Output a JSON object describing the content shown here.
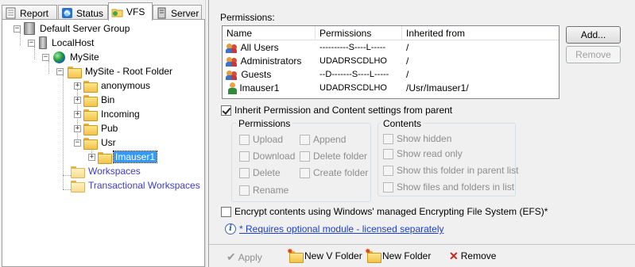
{
  "tabs": [
    {
      "label": "Report",
      "icon": "report-icon"
    },
    {
      "label": "Status",
      "icon": "status-icon"
    },
    {
      "label": "VFS",
      "icon": "vfs-folder-icon",
      "active": true
    },
    {
      "label": "Server",
      "icon": "server-tab-icon"
    }
  ],
  "tree": {
    "server_group": "Default Server Group",
    "host": "LocalHost",
    "site": "MySite",
    "root": "MySite - Root Folder",
    "folders": [
      "anonymous",
      "Bin",
      "Incoming",
      "Pub",
      "Usr"
    ],
    "selected_child": "Imauser1",
    "workspaces": "Workspaces",
    "transactional": "Transactional Workspaces"
  },
  "permissions": {
    "label": "Permissions:",
    "columns": [
      "Name",
      "Permissions",
      "Inherited from"
    ],
    "rows": [
      {
        "name": "All Users",
        "perms": "----------S----L-----",
        "inherited": "/",
        "icon": "user-group-icon"
      },
      {
        "name": "Administrators",
        "perms": "UDADRSCDLHO",
        "inherited": "/",
        "icon": "user-group-icon"
      },
      {
        "name": "Guests",
        "perms": "--D-------S----L-----",
        "inherited": "/",
        "icon": "user-group-icon"
      },
      {
        "name": "Imauser1",
        "perms": "UDADRSCDLHO",
        "inherited": "/Usr/Imauser1/",
        "icon": "user-icon"
      }
    ],
    "add_button": "Add...",
    "remove_button": "Remove"
  },
  "inherit": {
    "label": "Inherit Permission and Content settings from parent",
    "checked": true
  },
  "perm_group": {
    "title": "Permissions",
    "left": [
      "Upload",
      "Download",
      "Delete",
      "Rename"
    ],
    "right": [
      "Append",
      "Delete folder",
      "Create folder"
    ]
  },
  "contents_group": {
    "title": "Contents",
    "items": [
      "Show hidden",
      "Show read only",
      "Show this folder in parent list",
      "Show files and folders in list"
    ]
  },
  "encrypt": {
    "label": "Encrypt contents using Windows' managed Encrypting File System (EFS)*",
    "checked": false
  },
  "note": {
    "icon_text": "i",
    "link": "* Requires optional module - licensed separately"
  },
  "toolbar": {
    "apply": "Apply",
    "new_v_folder": "New V Folder",
    "new_folder": "New Folder",
    "remove": "Remove"
  },
  "colors": {
    "selection": "#3399ff",
    "link": "#1a3fd0",
    "workspace_text": "#3c3cc8",
    "remove_x": "#d2211e"
  }
}
